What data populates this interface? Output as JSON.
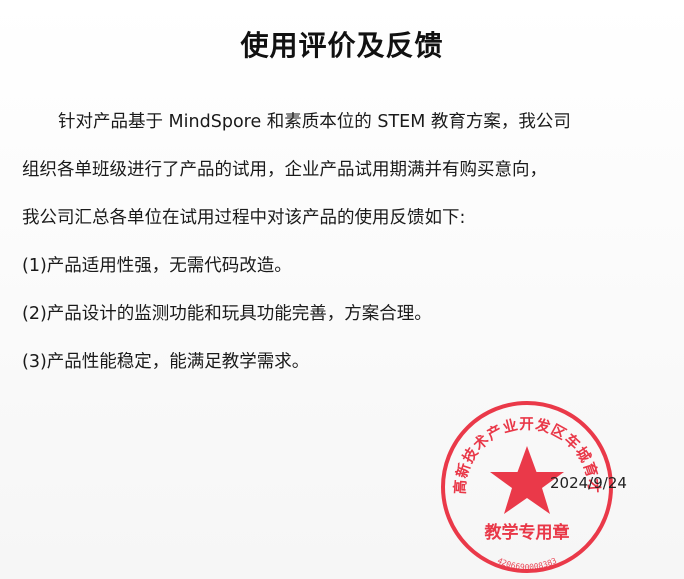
{
  "title": "使用评价及反馈",
  "paragraph": {
    "line1": "针对产品基于 MindSpore 和素质本位的 STEM 教育方案，我公司",
    "line2": "组织各单班级进行了产品的试用，企业产品试用期满并有购买意向，",
    "line3": "我公司汇总各单位在试用过程中对该产品的使用反馈如下:"
  },
  "items": [
    "(1)产品适用性强，无需代码改造。",
    "(2)产品设计的监测功能和玩具功能完善，方案合理。",
    "(3)产品性能稳定，能满足教学需求。"
  ],
  "stamp": {
    "arc_text": "襄阳高新技术产业开发区车城育才学校",
    "center_text": "教学专用章",
    "serial": "4206690008383",
    "color": "#e8283a"
  },
  "date": "2024/9/24"
}
